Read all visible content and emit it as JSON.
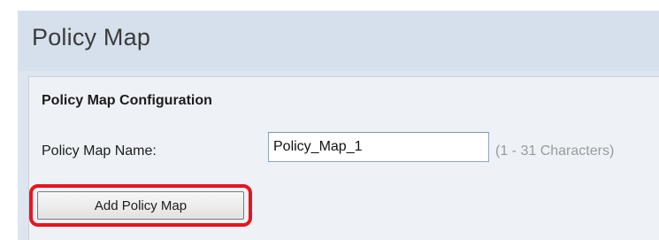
{
  "page": {
    "title": "Policy Map"
  },
  "config": {
    "heading": "Policy Map Configuration",
    "name_label": "Policy Map Name:",
    "name_value": "Policy_Map_1",
    "name_hint": "(1 - 31 Characters)",
    "add_button_label": "Add Policy Map"
  },
  "colors": {
    "header_bg": "#d5e0ec",
    "highlight": "#e8141f"
  }
}
